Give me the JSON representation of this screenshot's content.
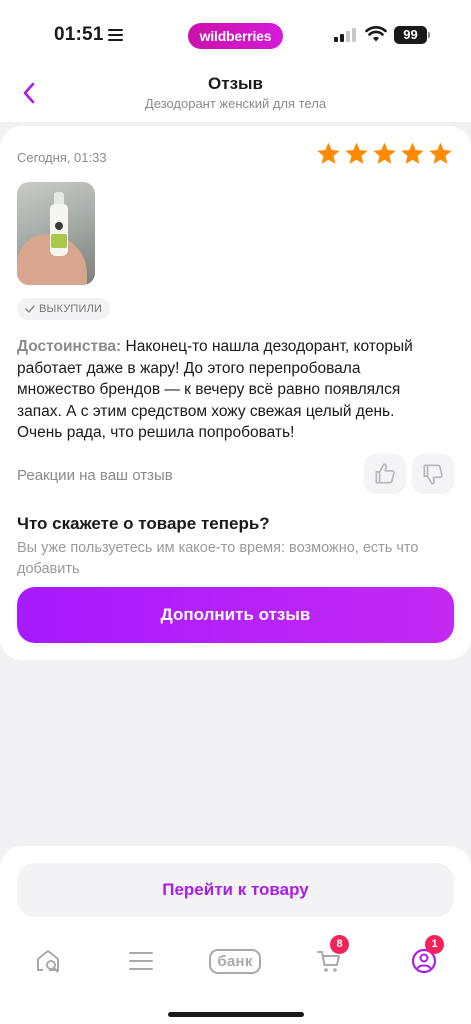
{
  "status_bar": {
    "time": "01:51",
    "brand": "wildberries",
    "battery": "99",
    "icons": [
      "menu-lines-icon",
      "signal-icon",
      "wifi-icon",
      "battery-icon"
    ]
  },
  "header": {
    "back_icon": "chevron-left-icon",
    "title": "Отзыв",
    "subtitle": "Дезодорант женский для тела"
  },
  "review": {
    "date": "Сегодня, 01:33",
    "rating": 5,
    "badge": "ВЫКУПИЛИ",
    "pros_label": "Достоинства:",
    "pros_text": "Наконец-то нашла дезодорант, который работает даже в жару! До этого перепробовала множество брендов — к вечеру всё равно появлялся запах. А с этим средством хожу свежая целый день. Очень рада, что решила попробовать!",
    "reactions_label": "Реакции на ваш отзыв",
    "followup_title": "Что скажете о товаре теперь?",
    "followup_subtitle": "Вы уже пользуетесь им какое-то время: возможно, есть что добавить",
    "add_review_button": "Дополнить отзыв"
  },
  "bottom": {
    "go_to_product_button": "Перейти к товару"
  },
  "tabbar": {
    "bank_label": "банк",
    "cart_badge": "8",
    "profile_badge": "1"
  },
  "colors": {
    "accent_purple": "#a81fe6",
    "brand_magenta": "#cb11ab",
    "star_orange": "#ff8a00",
    "badge_red": "#f0245b"
  }
}
